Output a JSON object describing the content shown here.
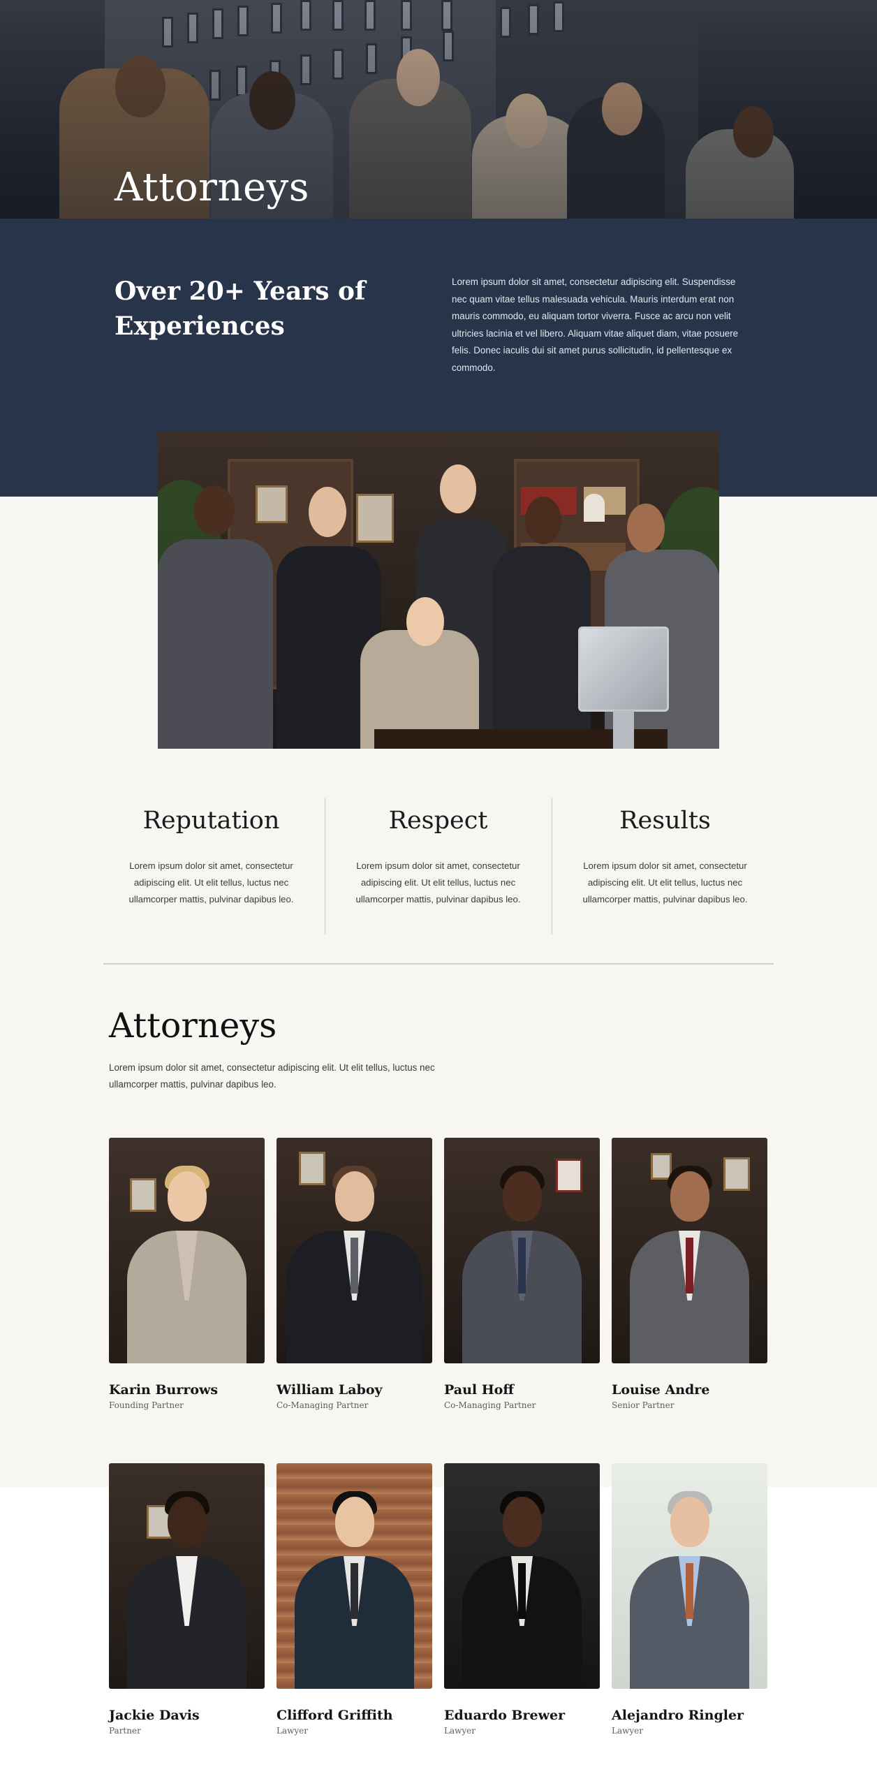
{
  "hero": {
    "title": "Attorneys"
  },
  "intro": {
    "heading": "Over 20+ Years of Experiences",
    "text": "Lorem ipsum dolor sit amet, consectetur adipiscing elit. Suspendisse nec quam vitae tellus malesuada vehicula. Mauris interdum erat non mauris commodo, eu aliquam tortor viverra. Fusce ac arcu non velit ultricies lacinia et vel libero. Aliquam vitae aliquet diam, vitae posuere felis. Donec iaculis dui sit amet purus sollicitudin, id pellentesque ex commodo."
  },
  "values": [
    {
      "title": "Reputation",
      "text": "Lorem ipsum dolor sit amet, consectetur adipiscing elit. Ut elit tellus, luctus nec ullamcorper mattis, pulvinar dapibus leo."
    },
    {
      "title": "Respect",
      "text": "Lorem ipsum dolor sit amet, consectetur adipiscing elit. Ut elit tellus, luctus nec ullamcorper mattis, pulvinar dapibus leo."
    },
    {
      "title": "Results",
      "text": "Lorem ipsum dolor sit amet, consectetur adipiscing elit. Ut elit tellus, luctus nec ullamcorper mattis, pulvinar dapibus leo."
    }
  ],
  "attorneys": {
    "title": "Attorneys",
    "text": "Lorem ipsum dolor sit amet, consectetur adipiscing elit. Ut elit tellus, luctus nec ullamcorper mattis, pulvinar dapibus leo.",
    "people": [
      {
        "name": "Karin Burrows",
        "role": "Founding Partner"
      },
      {
        "name": "William Laboy",
        "role": "Co-Managing Partner"
      },
      {
        "name": "Paul Hoff",
        "role": "Co-Managing Partner"
      },
      {
        "name": "Louise Andre",
        "role": "Senior Partner"
      },
      {
        "name": "Jackie Davis",
        "role": "Partner"
      },
      {
        "name": "Clifford Griffith",
        "role": "Lawyer"
      },
      {
        "name": "Eduardo Brewer",
        "role": "Lawyer"
      },
      {
        "name": "Alejandro Ringler",
        "role": "Lawyer"
      }
    ]
  },
  "colors": {
    "navy": "#27344a",
    "cream": "#f7f6f3",
    "text_dark": "#151515"
  }
}
